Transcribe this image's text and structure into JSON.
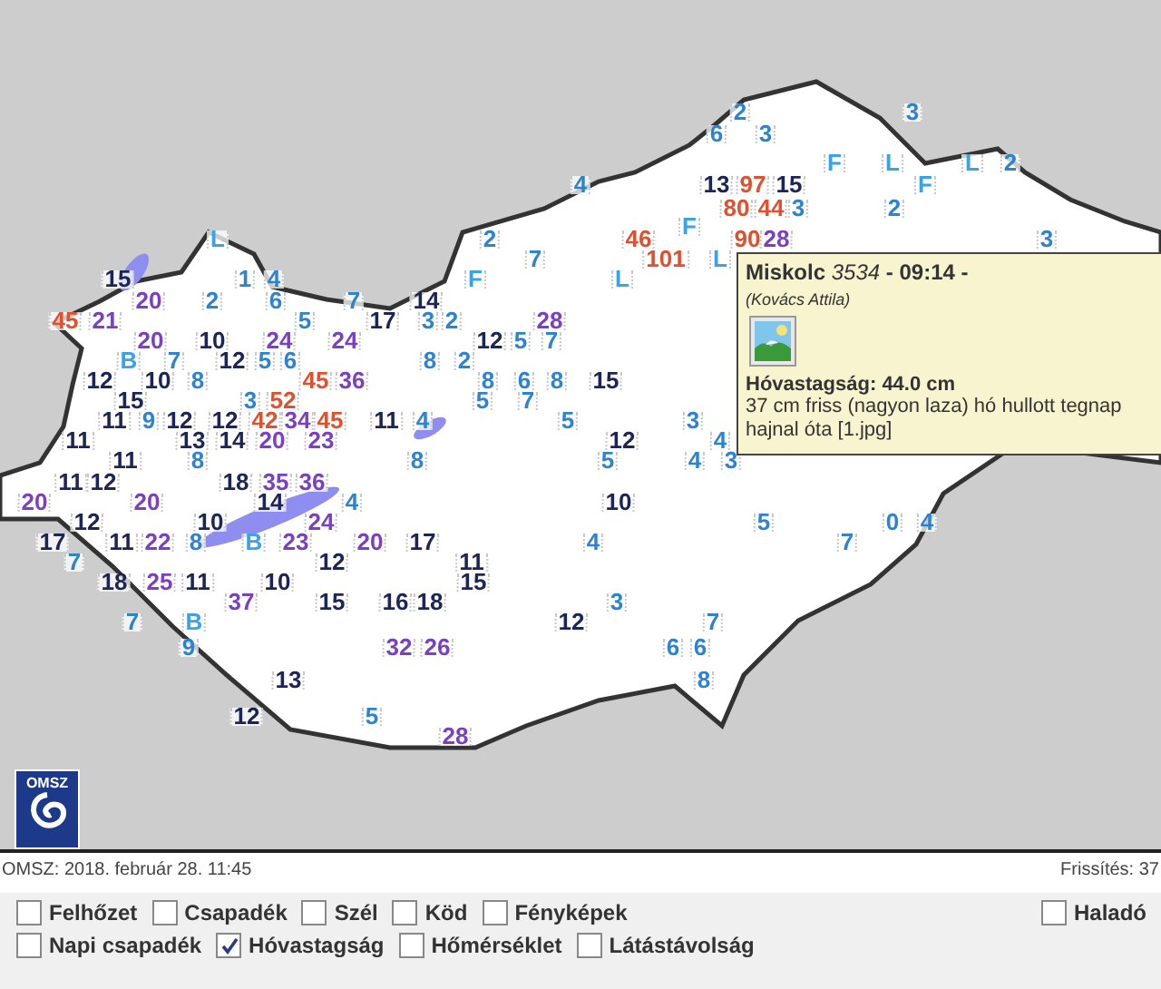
{
  "map": {
    "markers": [
      {
        "text": "2",
        "kind": "low"
      },
      {
        "text": "3",
        "kind": "low"
      },
      {
        "text": "6",
        "kind": "low"
      },
      {
        "text": "3",
        "kind": "low"
      },
      {
        "text": "F",
        "kind": "letter"
      },
      {
        "text": "L",
        "kind": "letter"
      },
      {
        "text": "L",
        "kind": "letter"
      },
      {
        "text": "2",
        "kind": "low"
      },
      {
        "text": "4",
        "kind": "low"
      },
      {
        "text": "13",
        "kind": "mid"
      },
      {
        "text": "97",
        "kind": "red"
      },
      {
        "text": "15",
        "kind": "mid"
      },
      {
        "text": "F",
        "kind": "letter"
      },
      {
        "text": "80",
        "kind": "red"
      },
      {
        "text": "44",
        "kind": "red"
      },
      {
        "text": "3",
        "kind": "low"
      },
      {
        "text": "2",
        "kind": "low"
      },
      {
        "text": "F",
        "kind": "letter"
      },
      {
        "text": "L",
        "kind": "letter"
      },
      {
        "text": "2",
        "kind": "low"
      },
      {
        "text": "46",
        "kind": "red"
      },
      {
        "text": "90",
        "kind": "red"
      },
      {
        "text": "28",
        "kind": "high"
      },
      {
        "text": "3",
        "kind": "low"
      },
      {
        "text": "7",
        "kind": "low"
      },
      {
        "text": "101",
        "kind": "red"
      },
      {
        "text": "L",
        "kind": "letter"
      },
      {
        "text": "15",
        "kind": "mid"
      },
      {
        "text": "1",
        "kind": "low"
      },
      {
        "text": "4",
        "kind": "low"
      },
      {
        "text": "F",
        "kind": "letter"
      },
      {
        "text": "L",
        "kind": "letter"
      },
      {
        "text": "20",
        "kind": "high"
      },
      {
        "text": "2",
        "kind": "low"
      },
      {
        "text": "6",
        "kind": "low"
      },
      {
        "text": "7",
        "kind": "low"
      },
      {
        "text": "14",
        "kind": "mid"
      },
      {
        "text": "45",
        "kind": "red"
      },
      {
        "text": "21",
        "kind": "high"
      },
      {
        "text": "5",
        "kind": "low"
      },
      {
        "text": "17",
        "kind": "mid"
      },
      {
        "text": "3",
        "kind": "low"
      },
      {
        "text": "2",
        "kind": "low"
      },
      {
        "text": "28",
        "kind": "high"
      },
      {
        "text": "20",
        "kind": "high"
      },
      {
        "text": "10",
        "kind": "mid"
      },
      {
        "text": "24",
        "kind": "high"
      },
      {
        "text": "24",
        "kind": "high"
      },
      {
        "text": "12",
        "kind": "mid"
      },
      {
        "text": "5",
        "kind": "low"
      },
      {
        "text": "7",
        "kind": "low"
      },
      {
        "text": "B",
        "kind": "letter"
      },
      {
        "text": "7",
        "kind": "low"
      },
      {
        "text": "12",
        "kind": "mid"
      },
      {
        "text": "5",
        "kind": "low"
      },
      {
        "text": "6",
        "kind": "low"
      },
      {
        "text": "8",
        "kind": "low"
      },
      {
        "text": "2",
        "kind": "low"
      },
      {
        "text": "12",
        "kind": "mid"
      },
      {
        "text": "10",
        "kind": "mid"
      },
      {
        "text": "8",
        "kind": "low"
      },
      {
        "text": "45",
        "kind": "red"
      },
      {
        "text": "36",
        "kind": "high"
      },
      {
        "text": "8",
        "kind": "low"
      },
      {
        "text": "6",
        "kind": "low"
      },
      {
        "text": "8",
        "kind": "low"
      },
      {
        "text": "15",
        "kind": "mid"
      },
      {
        "text": "15",
        "kind": "mid"
      },
      {
        "text": "3",
        "kind": "low"
      },
      {
        "text": "52",
        "kind": "red"
      },
      {
        "text": "5",
        "kind": "low"
      },
      {
        "text": "7",
        "kind": "low"
      },
      {
        "text": "11",
        "kind": "mid"
      },
      {
        "text": "9",
        "kind": "low"
      },
      {
        "text": "12",
        "kind": "mid"
      },
      {
        "text": "12",
        "kind": "mid"
      },
      {
        "text": "42",
        "kind": "red"
      },
      {
        "text": "34",
        "kind": "high"
      },
      {
        "text": "45",
        "kind": "red"
      },
      {
        "text": "11",
        "kind": "mid"
      },
      {
        "text": "4",
        "kind": "low"
      },
      {
        "text": "5",
        "kind": "low"
      },
      {
        "text": "3",
        "kind": "low"
      },
      {
        "text": "11",
        "kind": "mid"
      },
      {
        "text": "13",
        "kind": "mid"
      },
      {
        "text": "14",
        "kind": "mid"
      },
      {
        "text": "20",
        "kind": "high"
      },
      {
        "text": "23",
        "kind": "high"
      },
      {
        "text": "12",
        "kind": "mid"
      },
      {
        "text": "4",
        "kind": "low"
      },
      {
        "text": "11",
        "kind": "mid"
      },
      {
        "text": "8",
        "kind": "low"
      },
      {
        "text": "8",
        "kind": "low"
      },
      {
        "text": "5",
        "kind": "low"
      },
      {
        "text": "4",
        "kind": "low"
      },
      {
        "text": "3",
        "kind": "low"
      },
      {
        "text": "11",
        "kind": "mid"
      },
      {
        "text": "12",
        "kind": "mid"
      },
      {
        "text": "18",
        "kind": "mid"
      },
      {
        "text": "35",
        "kind": "high"
      },
      {
        "text": "36",
        "kind": "high"
      },
      {
        "text": "20",
        "kind": "high"
      },
      {
        "text": "20",
        "kind": "high"
      },
      {
        "text": "14",
        "kind": "mid"
      },
      {
        "text": "4",
        "kind": "low"
      },
      {
        "text": "10",
        "kind": "mid"
      },
      {
        "text": "12",
        "kind": "mid"
      },
      {
        "text": "10",
        "kind": "mid"
      },
      {
        "text": "24",
        "kind": "high"
      },
      {
        "text": "5",
        "kind": "low"
      },
      {
        "text": "0",
        "kind": "low"
      },
      {
        "text": "4",
        "kind": "low"
      },
      {
        "text": "17",
        "kind": "mid"
      },
      {
        "text": "11",
        "kind": "mid"
      },
      {
        "text": "22",
        "kind": "high"
      },
      {
        "text": "8",
        "kind": "low"
      },
      {
        "text": "B",
        "kind": "letter"
      },
      {
        "text": "23",
        "kind": "high"
      },
      {
        "text": "20",
        "kind": "high"
      },
      {
        "text": "17",
        "kind": "mid"
      },
      {
        "text": "4",
        "kind": "low"
      },
      {
        "text": "7",
        "kind": "low"
      },
      {
        "text": "7",
        "kind": "low"
      },
      {
        "text": "12",
        "kind": "mid"
      },
      {
        "text": "11",
        "kind": "mid"
      },
      {
        "text": "18",
        "kind": "mid"
      },
      {
        "text": "25",
        "kind": "high"
      },
      {
        "text": "11",
        "kind": "mid"
      },
      {
        "text": "10",
        "kind": "mid"
      },
      {
        "text": "15",
        "kind": "mid"
      },
      {
        "text": "37",
        "kind": "high"
      },
      {
        "text": "15",
        "kind": "mid"
      },
      {
        "text": "16",
        "kind": "mid"
      },
      {
        "text": "18",
        "kind": "mid"
      },
      {
        "text": "3",
        "kind": "low"
      },
      {
        "text": "7",
        "kind": "low"
      },
      {
        "text": "B",
        "kind": "letter"
      },
      {
        "text": "12",
        "kind": "mid"
      },
      {
        "text": "7",
        "kind": "low"
      },
      {
        "text": "9",
        "kind": "low"
      },
      {
        "text": "32",
        "kind": "high"
      },
      {
        "text": "26",
        "kind": "high"
      },
      {
        "text": "6",
        "kind": "low"
      },
      {
        "text": "6",
        "kind": "low"
      },
      {
        "text": "13",
        "kind": "mid"
      },
      {
        "text": "8",
        "kind": "low"
      },
      {
        "text": "12",
        "kind": "mid"
      },
      {
        "text": "5",
        "kind": "low"
      },
      {
        "text": "28",
        "kind": "high"
      }
    ],
    "logo": {
      "text": "OMSZ"
    },
    "popup": {
      "title": "**Miskolc** *3534* **- 09:14 -**",
      "observer": "(Kovács Attila)",
      "measurement": "Hóvastagság: 44.0 cm",
      "note": "37 cm friss (nagyon laza) hó hullott tegnap hajnal óta [1.jpg]"
    }
  },
  "status_bar": {
    "timestamp": "OMSZ: 2018. február 28. 11:45",
    "refresh": "Frissítés: 37"
  },
  "layer_rows": [
    [
      {
        "label": "Felhőzet",
        "checked": false
      },
      {
        "label": "Csapadék",
        "checked": false
      },
      {
        "label": "Szél",
        "checked": false
      },
      {
        "label": "Köd",
        "checked": false
      },
      {
        "label": "Fényképek",
        "checked": false
      }
    ],
    [
      {
        "label": "Napi csapadék",
        "checked": false
      },
      {
        "label": "Hóvastagság",
        "checked": true
      },
      {
        "label": "Hőmérséklet",
        "checked": false
      },
      {
        "label": "Látástávolság",
        "checked": false
      }
    ]
  ],
  "advanced_toggle": {
    "label": "Haladó",
    "checked": false
  }
}
